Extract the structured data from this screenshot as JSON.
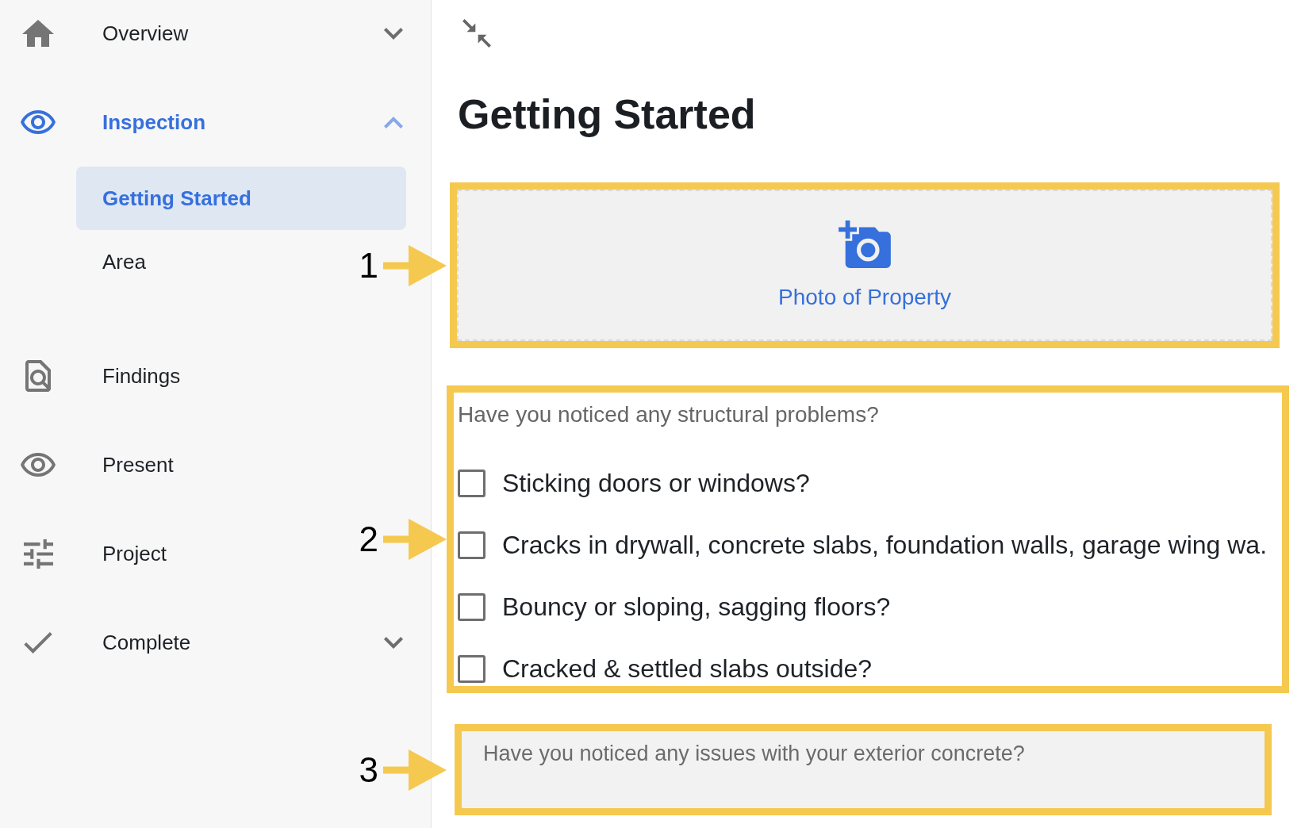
{
  "sidebar": {
    "items": [
      {
        "label": "Overview",
        "selected": false,
        "expanded": false
      },
      {
        "label": "Inspection",
        "selected": true,
        "expanded": true,
        "children": [
          {
            "label": "Getting Started",
            "selected": true
          },
          {
            "label": "Area",
            "selected": false
          }
        ]
      },
      {
        "label": "Findings",
        "selected": false
      },
      {
        "label": "Present",
        "selected": false
      },
      {
        "label": "Project",
        "selected": false
      },
      {
        "label": "Complete",
        "selected": false,
        "expanded": false
      }
    ]
  },
  "page": {
    "title": "Getting Started",
    "sections": [
      {
        "kind": "photo",
        "label": "Photo of Property",
        "callout": "1"
      },
      {
        "kind": "checklist",
        "question": "Have you noticed any structural problems?",
        "options": [
          {
            "label": "Sticking doors or windows?",
            "checked": false
          },
          {
            "label": "Cracks in drywall, concrete slabs, foundation walls, garage wing wa.",
            "checked": false
          },
          {
            "label": "Bouncy or sloping, sagging floors?",
            "checked": false
          },
          {
            "label": "Cracked & settled slabs outside?",
            "checked": false
          }
        ],
        "callout": "2"
      },
      {
        "kind": "text",
        "placeholder": "Have you noticed any issues with your exterior concrete?",
        "callout": "3"
      }
    ]
  }
}
